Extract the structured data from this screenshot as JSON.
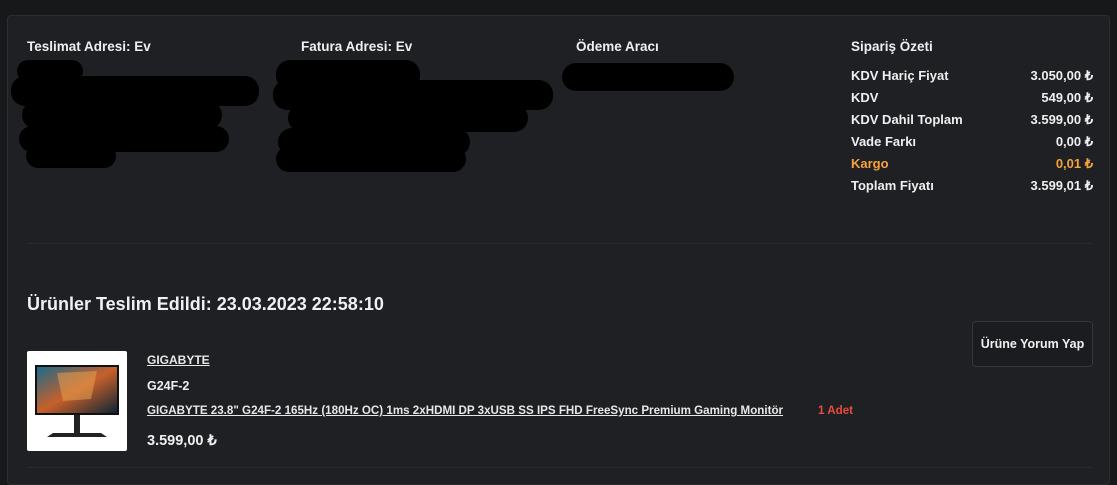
{
  "columns": {
    "shipping_title": "Teslimat Adresi: Ev",
    "billing_title": "Fatura Adresi: Ev",
    "payment_title": "Ödeme Aracı"
  },
  "summary": {
    "title": "Sipariş Özeti",
    "rows": [
      {
        "label": "KDV Hariç Fiyat",
        "value": "3.050,00 ₺"
      },
      {
        "label": "KDV",
        "value": "549,00 ₺"
      },
      {
        "label": "KDV Dahil Toplam",
        "value": "3.599,00 ₺"
      },
      {
        "label": "Vade Farkı",
        "value": "0,00 ₺"
      },
      {
        "label": "Kargo",
        "value": "0,01 ₺"
      },
      {
        "label": "Toplam Fiyatı",
        "value": "3.599,01 ₺"
      }
    ]
  },
  "delivery": {
    "heading": "Ürünler Teslim Edildi: 23.03.2023 22:58:10",
    "review_button": "Ürüne Yorum Yap"
  },
  "product": {
    "brand": "GIGABYTE",
    "model": "G24F-2",
    "description": "GIGABYTE 23.8\" G24F-2 165Hz (180Hz OC) 1ms 2xHDMI DP 3xUSB SS IPS FHD FreeSync Premium Gaming Monitör",
    "quantity": "1 Adet",
    "price": "3.599,00 ₺"
  },
  "colors": {
    "accent_orange": "#f7a23b",
    "quantity_red": "#e74c3c"
  }
}
